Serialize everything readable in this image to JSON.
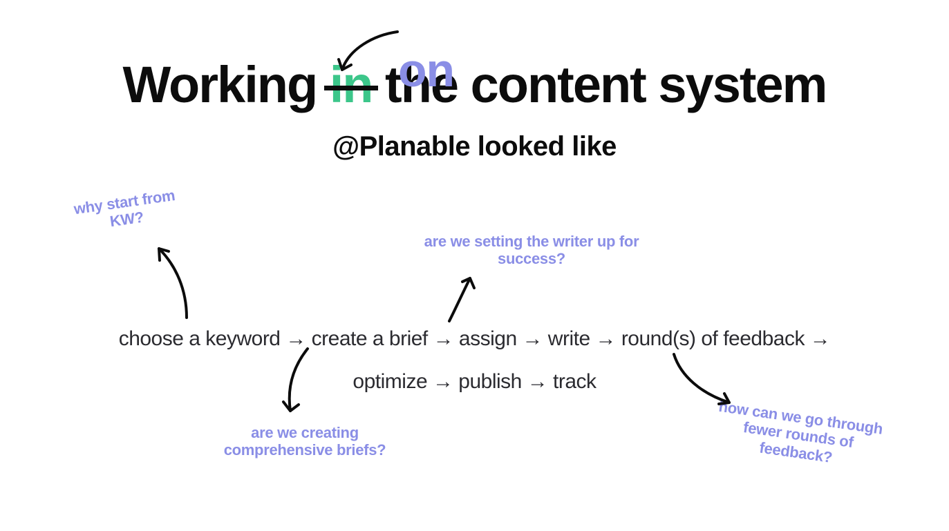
{
  "title": {
    "replacement_word": "on",
    "prefix": "Working ",
    "struck_word": "in",
    "suffix": " the content system",
    "subtitle": "@Planable looked like"
  },
  "flow": {
    "line1": "choose a keyword → create a brief → assign → write → round(s) of feedback →",
    "line2": "optimize → publish → track"
  },
  "annotations": {
    "why_start": "why start from\nKW?",
    "writer_success": "are we setting the writer up for success?",
    "comprehensive": "are we creating comprehensive briefs?",
    "fewer_rounds": "how can we go through fewer rounds of feedback?"
  },
  "colors": {
    "accent_purple": "#8a8ee6",
    "accent_green": "#3cc68a",
    "text_black": "#0c0c0c",
    "flow_text": "#2b2b30"
  }
}
